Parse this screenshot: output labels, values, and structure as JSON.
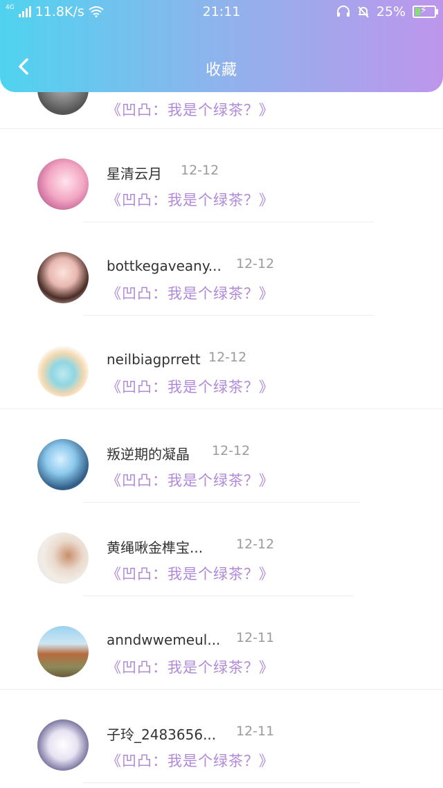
{
  "status_bar": {
    "network": "4G",
    "speed": "11.8K/s",
    "time": "21:11",
    "battery": "25%"
  },
  "header": {
    "title": "收藏",
    "back_icon": "chevron-left-icon"
  },
  "favorites": [
    {
      "name": "",
      "date": "",
      "work": "《凹凸：我是个绿茶？》"
    },
    {
      "name": "星清云月",
      "date": "12-12",
      "work": "《凹凸：我是个绿茶？》"
    },
    {
      "name": "bottkegaveany...",
      "date": "12-12",
      "work": "《凹凸：我是个绿茶？》"
    },
    {
      "name": "neilbiagprrett",
      "date": "12-12",
      "work": "《凹凸：我是个绿茶？》"
    },
    {
      "name": "叛逆期的凝晶",
      "date": "12-12",
      "work": "《凹凸：我是个绿茶？》"
    },
    {
      "name": "黄绳啾金榫宝...",
      "date": "12-12",
      "work": "《凹凸：我是个绿茶？》"
    },
    {
      "name": "anndwwemeul...",
      "date": "12-11",
      "work": "《凹凸：我是个绿茶？》"
    },
    {
      "name": "子玲_2483656...",
      "date": "12-11",
      "work": "《凹凸：我是个绿茶？》"
    }
  ],
  "colors": {
    "header_gradient_start": "#4fd3ef",
    "header_gradient_end": "#bd96ec",
    "work_title": "#b089d9",
    "date": "#9a9a9a"
  }
}
